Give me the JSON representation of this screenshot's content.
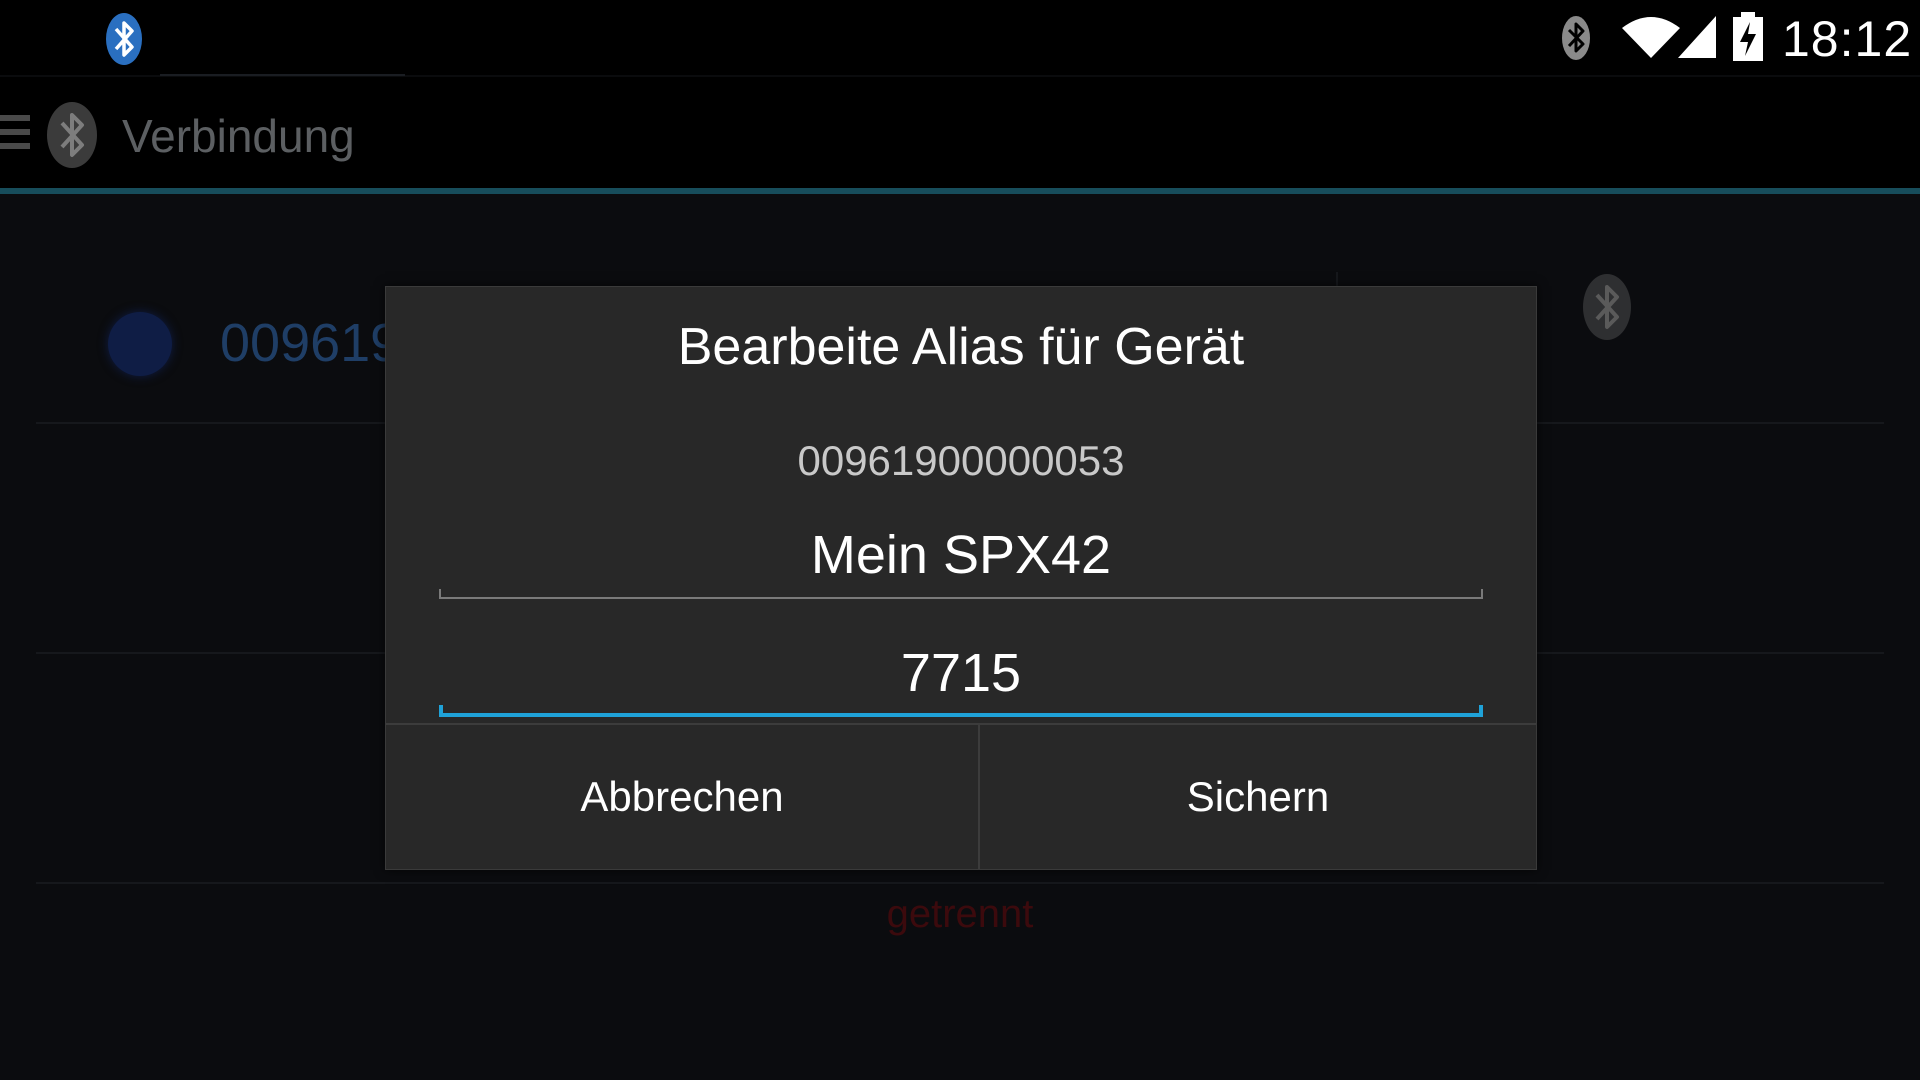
{
  "status_bar": {
    "time": "18:12",
    "icons": [
      "bluetooth-notification-icon",
      "bluetooth-icon",
      "wifi-icon",
      "cell-signal-icon",
      "battery-charging-icon"
    ]
  },
  "action_bar": {
    "title": "Verbindung",
    "icons": [
      "drawer-menu-icon",
      "bluetooth-app-icon"
    ]
  },
  "background": {
    "device_id_partial": "009619",
    "connection_status": "getrennt",
    "colors": {
      "status_dot": "#0f1d45",
      "device_id": "#1f3e66",
      "status_text": "#3c0a0d"
    }
  },
  "dialog": {
    "title": "Bearbeite Alias für Gerät",
    "device_address": "00961900000053",
    "alias_value": "Mein SPX42",
    "pin_value": "7715",
    "cancel_label": "Abbrechen",
    "save_label": "Sichern"
  },
  "colors": {
    "accent": "#1fa2d8",
    "dialog_bg": "#282828",
    "actionbar_line": "#174d5b"
  }
}
